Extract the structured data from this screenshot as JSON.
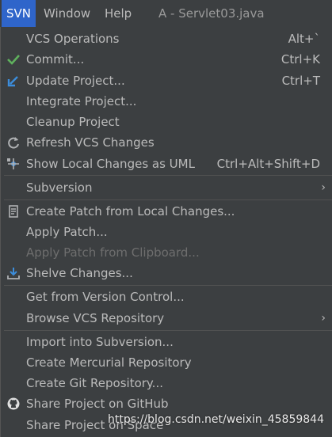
{
  "menubar": {
    "svn": "SVN",
    "window": "Window",
    "help": "Help",
    "title": "A - Servlet03.java"
  },
  "menu": {
    "vcs_operations": {
      "label": "VCS Operations",
      "shortcut": "Alt+`"
    },
    "commit": {
      "label": "Commit...",
      "shortcut": "Ctrl+K",
      "icon": "check-icon"
    },
    "update_project": {
      "label": "Update Project...",
      "shortcut": "Ctrl+T",
      "icon": "update-arrow-icon"
    },
    "integrate_project": {
      "label": "Integrate Project..."
    },
    "cleanup_project": {
      "label": "Cleanup Project"
    },
    "refresh_vcs": {
      "label": "Refresh VCS Changes",
      "icon": "refresh-icon"
    },
    "show_local_changes_uml": {
      "label": "Show Local Changes as UML",
      "shortcut": "Ctrl+Alt+Shift+D",
      "icon": "uml-icon"
    },
    "subversion": {
      "label": "Subversion",
      "arrow": "›"
    },
    "create_patch": {
      "label": "Create Patch from Local Changes...",
      "icon": "patch-icon"
    },
    "apply_patch": {
      "label": "Apply Patch..."
    },
    "apply_patch_clipboard": {
      "label": "Apply Patch from Clipboard..."
    },
    "shelve_changes": {
      "label": "Shelve Changes...",
      "icon": "shelve-icon"
    },
    "get_from_vc": {
      "label": "Get from Version Control..."
    },
    "browse_vcs": {
      "label": "Browse VCS Repository",
      "arrow": "›"
    },
    "import_subversion": {
      "label": "Import into Subversion..."
    },
    "create_mercurial": {
      "label": "Create Mercurial Repository"
    },
    "create_git": {
      "label": "Create Git Repository..."
    },
    "share_github": {
      "label": "Share Project on GitHub",
      "icon": "github-icon"
    },
    "share_space": {
      "label": "Share Project on Space"
    }
  },
  "watermark": "https://blog.csdn.net/weixin_45859844",
  "colors": {
    "background": "#3c3f41",
    "accent": "#2f65ca",
    "text": "#bbbbbb",
    "disabled": "#6e6e6e"
  }
}
